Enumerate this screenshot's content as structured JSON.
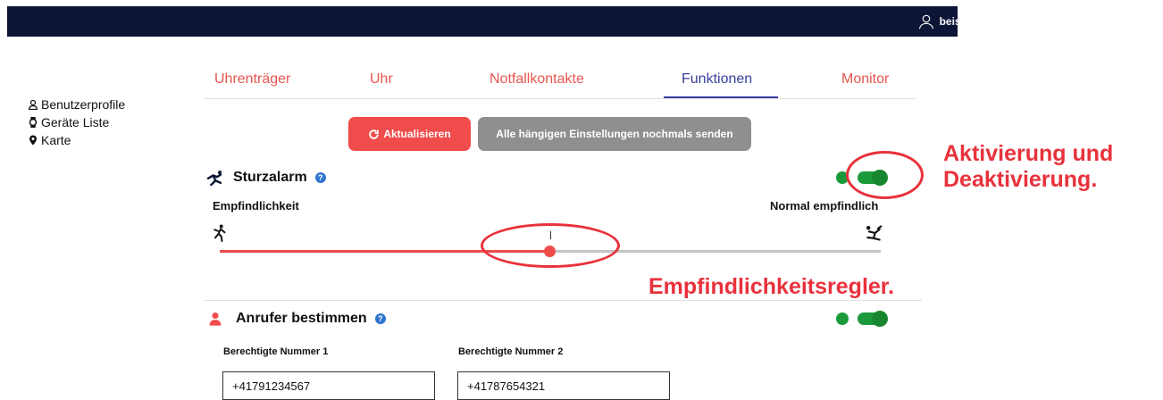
{
  "header": {
    "user_email": "beispiel@caretaker.net"
  },
  "sidebar": {
    "items": [
      {
        "label": "Benutzerprofile",
        "icon": "user-icon"
      },
      {
        "label": "Geräte Liste",
        "icon": "watch-icon"
      },
      {
        "label": "Karte",
        "icon": "map-pin-icon"
      }
    ]
  },
  "tabs": [
    {
      "label": "Uhrenträger"
    },
    {
      "label": "Uhr"
    },
    {
      "label": "Notfallkontakte"
    },
    {
      "label": "Funktionen",
      "active": true
    },
    {
      "label": "Monitor"
    }
  ],
  "actions": {
    "refresh_label": "Aktualisieren",
    "resend_label": "Alle hängigen Einstellungen nochmals senden"
  },
  "fall_alarm": {
    "title": "Sturzalarm",
    "help": "?",
    "enabled": true,
    "sensitivity_label": "Empfindlichkeit",
    "sensitivity_value": "Normal empfindlich",
    "slider_fraction": 0.5
  },
  "caller": {
    "title": "Anrufer bestimmen",
    "help": "?",
    "enabled": true,
    "number1_label": "Berechtigte Nummer 1",
    "number1_value": "+41791234567",
    "number2_label": "Berechtigte Nummer 2",
    "number2_value": "+41787654321"
  },
  "annotations": {
    "toggle_line1": "Aktivierung und",
    "toggle_line2": "Deaktivierung.",
    "slider_note": "Empfindlichkeitsregler."
  },
  "colors": {
    "accent": "#ef4c4b",
    "active_tab": "#3a3f9c",
    "toggle_on": "#1a9a3a",
    "annotation": "#e8323c",
    "topbar": "#0d1536"
  }
}
